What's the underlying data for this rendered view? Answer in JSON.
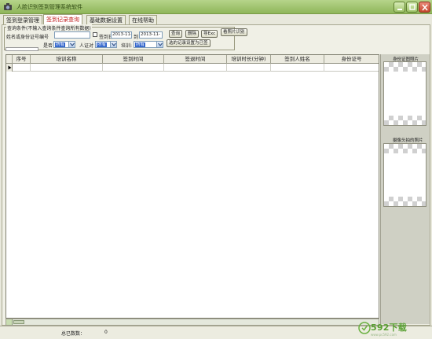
{
  "window": {
    "title": "人脸识别签到管理系统软件"
  },
  "tabs": [
    "签到登录管理",
    "签到记录查询",
    "基础数据设置",
    "在线帮助"
  ],
  "active_tab": 1,
  "query": {
    "legend": "查询条件(不输入查询条件查询所有数据)",
    "name_label": "姓名或身份证号编号",
    "name_value": "",
    "sign_time_label": "签到日",
    "date_from": "2013-11-",
    "to_label": "到",
    "date_to": "2013-11-",
    "gender_label": "是否",
    "gender_value": "所有",
    "verified_label": "人证对",
    "verified_value": "所有",
    "training_label": "培训:",
    "training_value": "所有",
    "btn_query": "查询",
    "btn_delete": "删除",
    "btn_export": "导Exc",
    "btn_photo": "看照片识别",
    "btn_mark": "选的记录设置为已签"
  },
  "grid": {
    "columns": [
      "序号",
      "培训名称",
      "签到时间",
      "签退时间",
      "培训时长(分钟)",
      "签到人姓名",
      "身份证号"
    ],
    "rows": [
      [
        "",
        "",
        "",
        "",
        "",
        "",
        ""
      ]
    ]
  },
  "side": {
    "photo1_label": "身份证图照片",
    "photo2_label": "摄像头拍的照片"
  },
  "status": {
    "label": "总已数数：",
    "value": "0"
  },
  "watermark": {
    "text": "592下载",
    "sub": "www.pc592.com"
  },
  "colors": {
    "titlebar": "#8fb65a",
    "active_tab_text": "#c02020",
    "select_highlight": "#3366cc",
    "watermark": "#58a032"
  }
}
